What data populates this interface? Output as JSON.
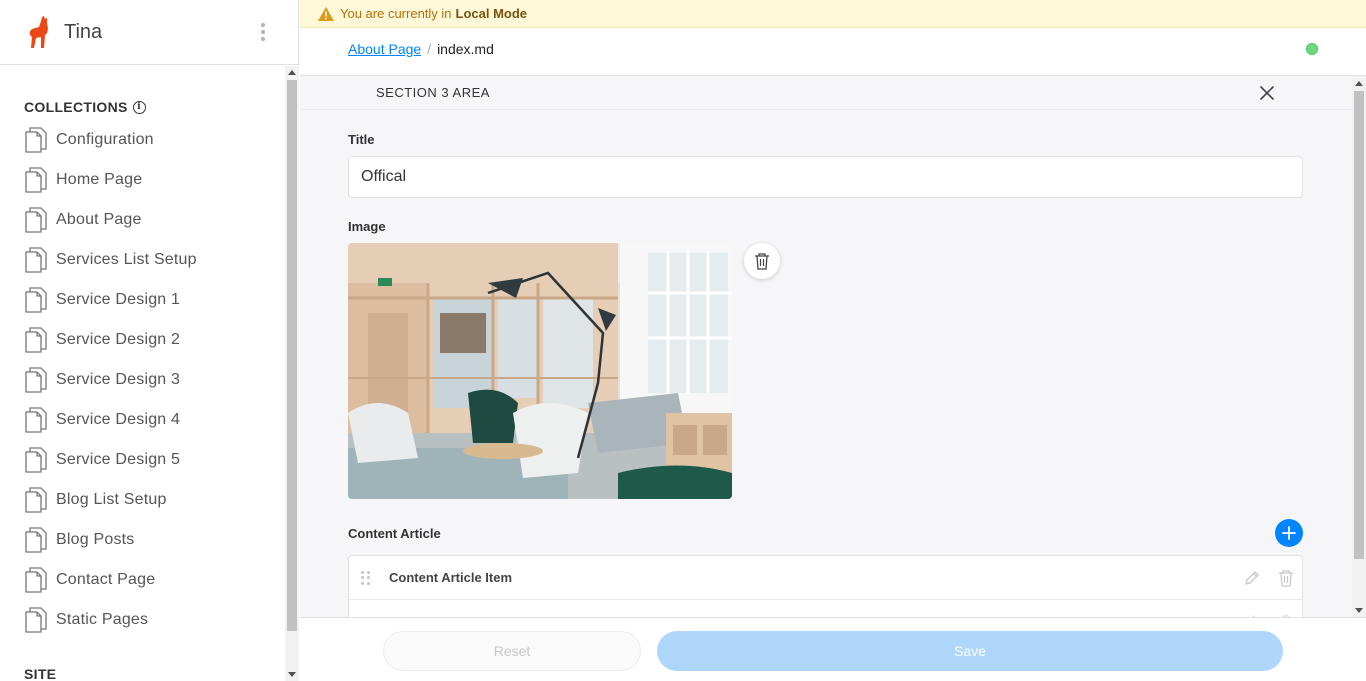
{
  "app": {
    "title": "Tina"
  },
  "sidebar": {
    "collections_heading": "COLLECTIONS",
    "collections": [
      {
        "label": "Configuration"
      },
      {
        "label": "Home Page"
      },
      {
        "label": "About Page"
      },
      {
        "label": "Services List Setup"
      },
      {
        "label": "Service Design 1"
      },
      {
        "label": "Service Design 2"
      },
      {
        "label": "Service Design 3"
      },
      {
        "label": "Service Design 4"
      },
      {
        "label": "Service Design 5"
      },
      {
        "label": "Blog List Setup"
      },
      {
        "label": "Blog Posts"
      },
      {
        "label": "Contact Page"
      },
      {
        "label": "Static Pages"
      }
    ],
    "site_heading": "SITE"
  },
  "banner": {
    "prefix": "You are currently in",
    "mode": "Local Mode"
  },
  "breadcrumb": {
    "parent": "About Page",
    "separator": "/",
    "current": "index.md"
  },
  "status": {
    "color": "#6cd97e"
  },
  "panel": {
    "title": "SECTION 3 AREA"
  },
  "form": {
    "title_label": "Title",
    "title_value": "Offical",
    "image_label": "Image",
    "content_label": "Content Article",
    "items": [
      {
        "label": "Content Article Item"
      }
    ]
  },
  "footer": {
    "reset_label": "Reset",
    "save_label": "Save"
  },
  "colors": {
    "accent": "#0084ff",
    "save_disabled": "#aed6fb",
    "banner_bg": "#fdf8d7",
    "logo": "#ec4815"
  }
}
